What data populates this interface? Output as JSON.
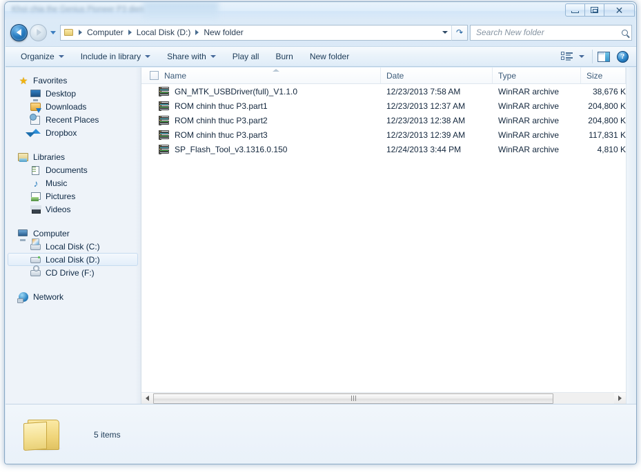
{
  "window": {
    "title": "Khoi chia the Genius Pioneer P3 dien",
    "controls": {
      "minimize": "Minimize",
      "maximize": "Maximize",
      "close": "Close"
    }
  },
  "address_bar": {
    "back_label": "Back",
    "forward_label": "Forward",
    "recent_label": "Recent pages",
    "breadcrumbs": [
      "Computer",
      "Local Disk (D:)",
      "New folder"
    ],
    "refresh_label": "Refresh"
  },
  "search": {
    "placeholder": "Search New folder",
    "value": ""
  },
  "toolbar": {
    "items": [
      {
        "label": "Organize",
        "has_caret": true
      },
      {
        "label": "Include in library",
        "has_caret": true
      },
      {
        "label": "Share with",
        "has_caret": true
      },
      {
        "label": "Play all",
        "has_caret": false
      },
      {
        "label": "Burn",
        "has_caret": false
      },
      {
        "label": "New folder",
        "has_caret": false
      }
    ],
    "view_label": "Change your view",
    "preview_label": "Show the preview pane",
    "help_label": "?"
  },
  "sidebar": {
    "groups": [
      {
        "header": {
          "label": "Favorites",
          "icon": "star-icon"
        },
        "items": [
          {
            "label": "Desktop",
            "icon": "monitor-icon"
          },
          {
            "label": "Downloads",
            "icon": "downloads-folder-icon"
          },
          {
            "label": "Recent Places",
            "icon": "recent-places-icon"
          },
          {
            "label": "Dropbox",
            "icon": "dropbox-icon"
          }
        ]
      },
      {
        "header": {
          "label": "Libraries",
          "icon": "libraries-icon"
        },
        "items": [
          {
            "label": "Documents",
            "icon": "document-icon"
          },
          {
            "label": "Music",
            "icon": "music-note-icon"
          },
          {
            "label": "Pictures",
            "icon": "picture-icon"
          },
          {
            "label": "Videos",
            "icon": "video-icon"
          }
        ]
      },
      {
        "header": {
          "label": "Computer",
          "icon": "computer-icon"
        },
        "items": [
          {
            "label": "Local Disk (C:)",
            "icon": "system-drive-icon",
            "selected": false
          },
          {
            "label": "Local Disk (D:)",
            "icon": "drive-icon",
            "selected": true
          },
          {
            "label": "CD Drive (F:)",
            "icon": "cd-drive-icon",
            "selected": false
          }
        ]
      },
      {
        "header": {
          "label": "Network",
          "icon": "network-icon"
        },
        "items": []
      }
    ]
  },
  "file_list": {
    "columns": [
      "Name",
      "Date",
      "Type",
      "Size"
    ],
    "sort_column": "Name",
    "sort_direction": "ascending",
    "rows": [
      {
        "name": "GN_MTK_USBDriver(full)_V1.1.0",
        "date": "12/23/2013 7:58 AM",
        "type": "WinRAR archive",
        "size": "38,676 K",
        "icon": "winrar-archive-icon"
      },
      {
        "name": "ROM chinh thuc P3.part1",
        "date": "12/23/2013 12:37 AM",
        "type": "WinRAR archive",
        "size": "204,800 K",
        "icon": "winrar-archive-icon"
      },
      {
        "name": "ROM chinh thuc P3.part2",
        "date": "12/23/2013 12:38 AM",
        "type": "WinRAR archive",
        "size": "204,800 K",
        "icon": "winrar-archive-icon"
      },
      {
        "name": "ROM chinh thuc P3.part3",
        "date": "12/23/2013 12:39 AM",
        "type": "WinRAR archive",
        "size": "117,831 K",
        "icon": "winrar-archive-icon"
      },
      {
        "name": "SP_Flash_Tool_v3.1316.0.150",
        "date": "12/24/2013 3:44 PM",
        "type": "WinRAR archive",
        "size": "4,810 K",
        "icon": "winrar-archive-icon"
      }
    ]
  },
  "status_bar": {
    "items_text": "5 items",
    "folder_icon": "open-folder-icon"
  },
  "colors": {
    "window_frame": "#8aa8c4",
    "titlebar_gradient_top": "#e9f3fb",
    "toolbar_bg": "#eaf2fa",
    "sidebar_bg": "#eef3f9",
    "selection": "#e3eefa",
    "text_primary": "#12263c",
    "text_header": "#3b5a78",
    "accent_blue": "#2d86c9"
  }
}
